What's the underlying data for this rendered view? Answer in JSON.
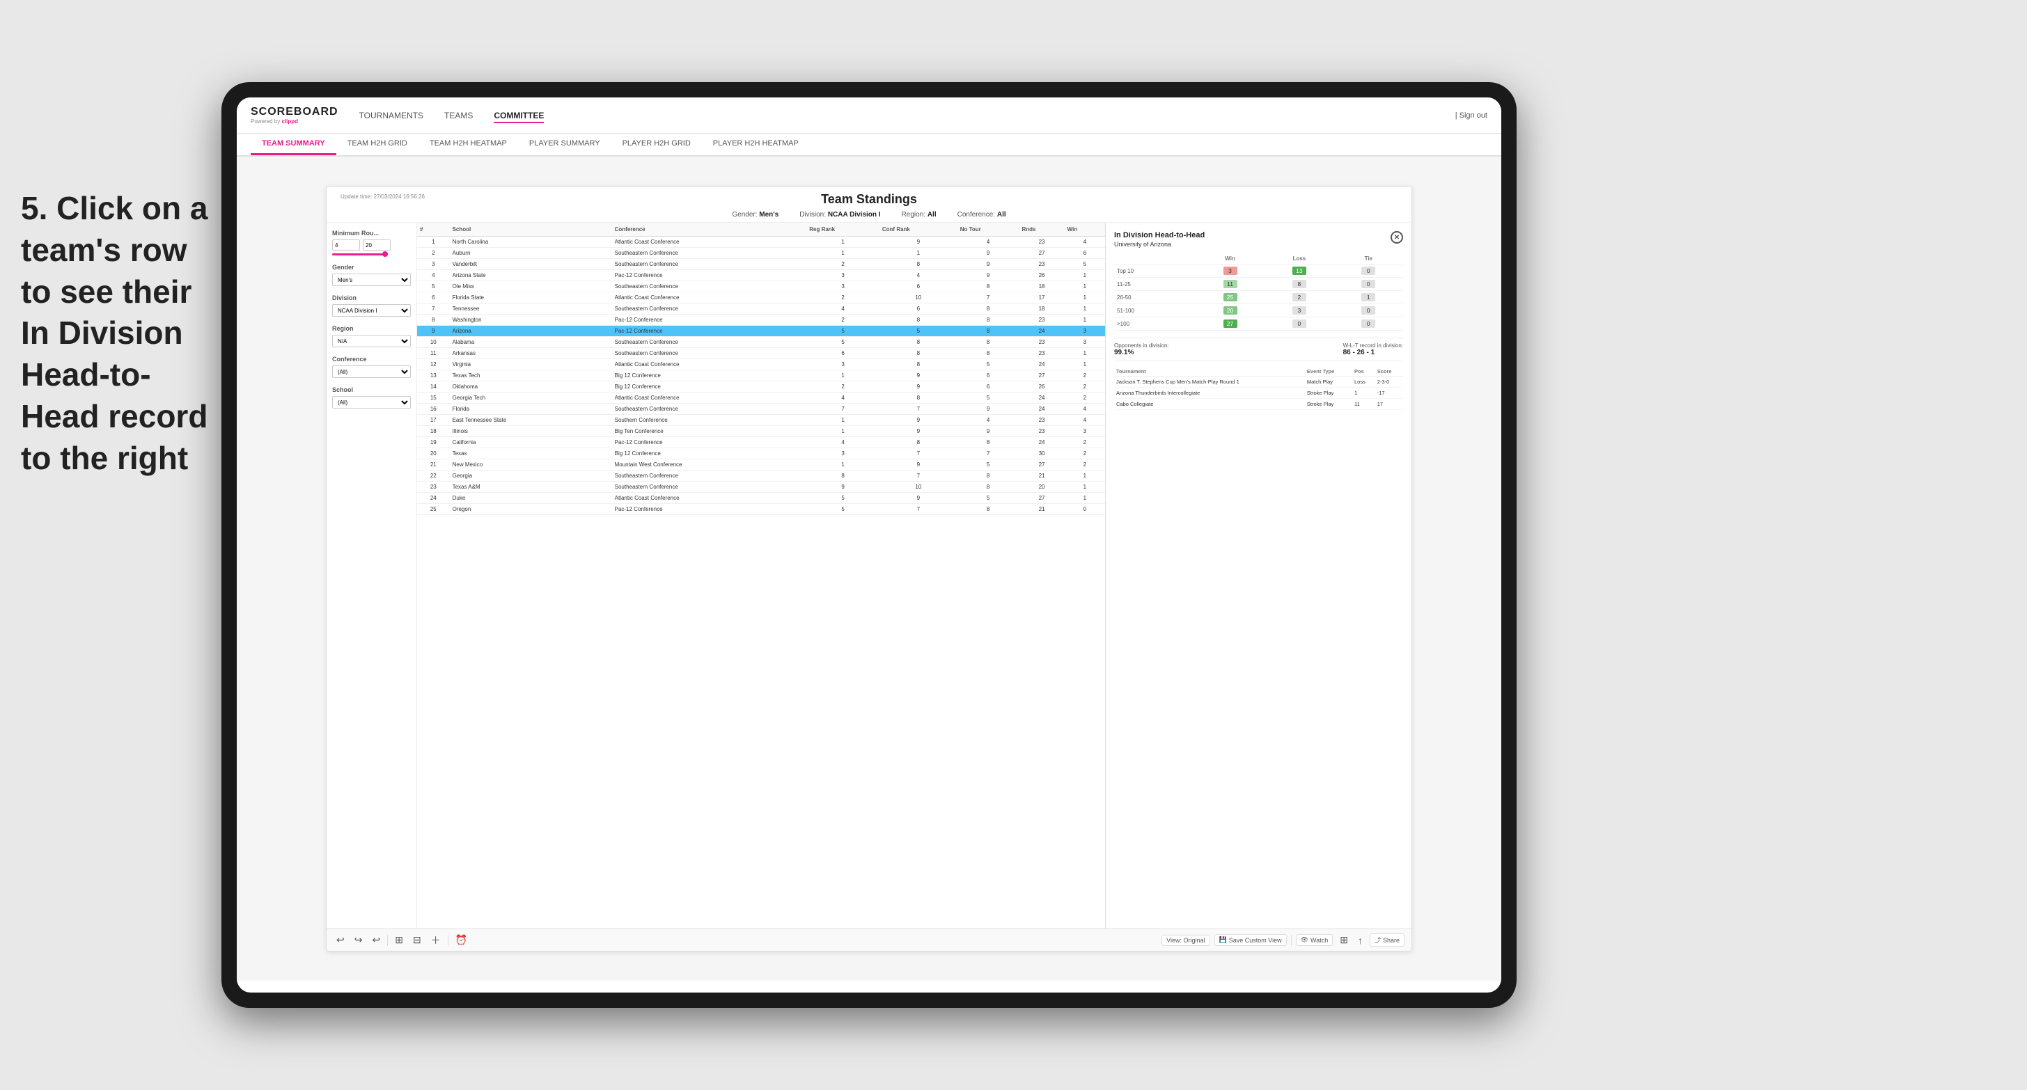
{
  "instruction": {
    "step": "5.",
    "text": "Click on a team's row to see their In Division Head-to-Head record to the right"
  },
  "tablet": {
    "nav": {
      "logo": "SCOREBOARD",
      "powered_by": "Powered by",
      "brand": "clippd",
      "links": [
        "TOURNAMENTS",
        "TEAMS",
        "COMMITTEE"
      ],
      "active_link": "COMMITTEE",
      "sign_out": "Sign out"
    },
    "sub_nav": {
      "links": [
        "TEAM SUMMARY",
        "TEAM H2H GRID",
        "TEAM H2H HEATMAP",
        "PLAYER SUMMARY",
        "PLAYER H2H GRID",
        "PLAYER H2H HEATMAP"
      ],
      "active": "TEAM SUMMARY"
    },
    "panel": {
      "update_time_label": "Update time:",
      "update_time": "27/03/2024 16:56:26",
      "title": "Team Standings",
      "filters": {
        "gender_label": "Gender:",
        "gender_value": "Men's",
        "division_label": "Division:",
        "division_value": "NCAA Division I",
        "region_label": "Region:",
        "region_value": "All",
        "conference_label": "Conference:",
        "conference_value": "All"
      },
      "sidebar_filters": {
        "min_rou_label": "Minimum Rou...",
        "min_value": "4",
        "max_value": "20",
        "gender_label": "Gender",
        "gender_select": "Men's",
        "division_label": "Division",
        "division_select": "NCAA Division I",
        "region_label": "Region",
        "region_select": "N/A",
        "conference_label": "Conference",
        "conference_select": "(All)",
        "school_label": "School",
        "school_select": "(All)"
      },
      "table": {
        "headers": [
          "#",
          "School",
          "Conference",
          "Reg Rank",
          "Conf Rank",
          "No Tour",
          "Rnds",
          "Win"
        ],
        "rows": [
          {
            "rank": "1",
            "school": "North Carolina",
            "conference": "Atlantic Coast Conference",
            "reg_rank": "1",
            "conf_rank": "9",
            "no_tour": "4",
            "rnds": "23",
            "win": "4"
          },
          {
            "rank": "2",
            "school": "Auburn",
            "conference": "Southeastern Conference",
            "reg_rank": "1",
            "conf_rank": "1",
            "no_tour": "9",
            "rnds": "27",
            "win": "6"
          },
          {
            "rank": "3",
            "school": "Vanderbilt",
            "conference": "Southeastern Conference",
            "reg_rank": "2",
            "conf_rank": "8",
            "no_tour": "9",
            "rnds": "23",
            "win": "5"
          },
          {
            "rank": "4",
            "school": "Arizona State",
            "conference": "Pac-12 Conference",
            "reg_rank": "3",
            "conf_rank": "4",
            "no_tour": "9",
            "rnds": "26",
            "win": "1"
          },
          {
            "rank": "5",
            "school": "Ole Miss",
            "conference": "Southeastern Conference",
            "reg_rank": "3",
            "conf_rank": "6",
            "no_tour": "8",
            "rnds": "18",
            "win": "1"
          },
          {
            "rank": "6",
            "school": "Florida State",
            "conference": "Atlantic Coast Conference",
            "reg_rank": "2",
            "conf_rank": "10",
            "no_tour": "7",
            "rnds": "17",
            "win": "1"
          },
          {
            "rank": "7",
            "school": "Tennessee",
            "conference": "Southeastern Conference",
            "reg_rank": "4",
            "conf_rank": "6",
            "no_tour": "8",
            "rnds": "18",
            "win": "1"
          },
          {
            "rank": "8",
            "school": "Washington",
            "conference": "Pac-12 Conference",
            "reg_rank": "2",
            "conf_rank": "8",
            "no_tour": "8",
            "rnds": "23",
            "win": "1"
          },
          {
            "rank": "9",
            "school": "Arizona",
            "conference": "Pac-12 Conference",
            "reg_rank": "5",
            "conf_rank": "5",
            "no_tour": "8",
            "rnds": "24",
            "win": "3",
            "selected": true
          },
          {
            "rank": "10",
            "school": "Alabama",
            "conference": "Southeastern Conference",
            "reg_rank": "5",
            "conf_rank": "8",
            "no_tour": "8",
            "rnds": "23",
            "win": "3"
          },
          {
            "rank": "11",
            "school": "Arkansas",
            "conference": "Southeastern Conference",
            "reg_rank": "6",
            "conf_rank": "8",
            "no_tour": "8",
            "rnds": "23",
            "win": "1"
          },
          {
            "rank": "12",
            "school": "Virginia",
            "conference": "Atlantic Coast Conference",
            "reg_rank": "3",
            "conf_rank": "8",
            "no_tour": "5",
            "rnds": "24",
            "win": "1"
          },
          {
            "rank": "13",
            "school": "Texas Tech",
            "conference": "Big 12 Conference",
            "reg_rank": "1",
            "conf_rank": "9",
            "no_tour": "6",
            "rnds": "27",
            "win": "2"
          },
          {
            "rank": "14",
            "school": "Oklahoma",
            "conference": "Big 12 Conference",
            "reg_rank": "2",
            "conf_rank": "9",
            "no_tour": "6",
            "rnds": "26",
            "win": "2"
          },
          {
            "rank": "15",
            "school": "Georgia Tech",
            "conference": "Atlantic Coast Conference",
            "reg_rank": "4",
            "conf_rank": "8",
            "no_tour": "5",
            "rnds": "24",
            "win": "2"
          },
          {
            "rank": "16",
            "school": "Florida",
            "conference": "Southeastern Conference",
            "reg_rank": "7",
            "conf_rank": "7",
            "no_tour": "9",
            "rnds": "24",
            "win": "4"
          },
          {
            "rank": "17",
            "school": "East Tennessee State",
            "conference": "Southern Conference",
            "reg_rank": "1",
            "conf_rank": "9",
            "no_tour": "4",
            "rnds": "23",
            "win": "4"
          },
          {
            "rank": "18",
            "school": "Illinois",
            "conference": "Big Ten Conference",
            "reg_rank": "1",
            "conf_rank": "9",
            "no_tour": "9",
            "rnds": "23",
            "win": "3"
          },
          {
            "rank": "19",
            "school": "California",
            "conference": "Pac-12 Conference",
            "reg_rank": "4",
            "conf_rank": "8",
            "no_tour": "8",
            "rnds": "24",
            "win": "2"
          },
          {
            "rank": "20",
            "school": "Texas",
            "conference": "Big 12 Conference",
            "reg_rank": "3",
            "conf_rank": "7",
            "no_tour": "7",
            "rnds": "30",
            "win": "2"
          },
          {
            "rank": "21",
            "school": "New Mexico",
            "conference": "Mountain West Conference",
            "reg_rank": "1",
            "conf_rank": "9",
            "no_tour": "5",
            "rnds": "27",
            "win": "2"
          },
          {
            "rank": "22",
            "school": "Georgia",
            "conference": "Southeastern Conference",
            "reg_rank": "8",
            "conf_rank": "7",
            "no_tour": "8",
            "rnds": "21",
            "win": "1"
          },
          {
            "rank": "23",
            "school": "Texas A&M",
            "conference": "Southeastern Conference",
            "reg_rank": "9",
            "conf_rank": "10",
            "no_tour": "8",
            "rnds": "20",
            "win": "1"
          },
          {
            "rank": "24",
            "school": "Duke",
            "conference": "Atlantic Coast Conference",
            "reg_rank": "5",
            "conf_rank": "9",
            "no_tour": "5",
            "rnds": "27",
            "win": "1"
          },
          {
            "rank": "25",
            "school": "Oregon",
            "conference": "Pac-12 Conference",
            "reg_rank": "5",
            "conf_rank": "7",
            "no_tour": "8",
            "rnds": "21",
            "win": "0"
          }
        ]
      },
      "h2h": {
        "title": "In Division Head-to-Head",
        "team": "University of Arizona",
        "table_headers": [
          "",
          "Win",
          "Loss",
          "Tie"
        ],
        "rows": [
          {
            "range": "Top 10",
            "win": "3",
            "loss": "13",
            "tie": "0",
            "win_class": "loss",
            "loss_class": "win"
          },
          {
            "range": "11-25",
            "win": "11",
            "loss": "8",
            "tie": "0",
            "win_class": "win",
            "loss_class": "neutral"
          },
          {
            "range": "26-50",
            "win": "25",
            "loss": "2",
            "tie": "1",
            "win_class": "win2",
            "loss_class": "neutral"
          },
          {
            "range": "51-100",
            "win": "20",
            "loss": "3",
            "tie": "0",
            "win_class": "win2",
            "loss_class": "neutral"
          },
          {
            "range": ">100",
            "win": "27",
            "loss": "0",
            "tie": "0",
            "win_class": "win3",
            "loss_class": "neutral"
          }
        ],
        "opponents_label": "Opponents in division:",
        "opponents_value": "99.1%",
        "wlt_label": "W-L-T record in division:",
        "wlt_value": "86 - 26 - 1",
        "tournament_headers": [
          "Tournament",
          "Event Type",
          "Pos",
          "Score"
        ],
        "tournaments": [
          {
            "name": "Jackson T. Stephens Cup Men's Match-Play Round 1",
            "type": "Match Play",
            "pos": "Loss",
            "score": "2-3-0"
          },
          {
            "name": "Arizona Thunderbirds Intercollegiate",
            "type": "Stroke Play",
            "pos": "1",
            "score": "-17"
          },
          {
            "name": "Cabo Collegiate",
            "type": "Stroke Play",
            "pos": "11",
            "score": "17"
          }
        ]
      },
      "toolbar": {
        "view_original": "View: Original",
        "save_custom": "Save Custom View",
        "watch": "Watch",
        "share": "Share"
      }
    }
  }
}
